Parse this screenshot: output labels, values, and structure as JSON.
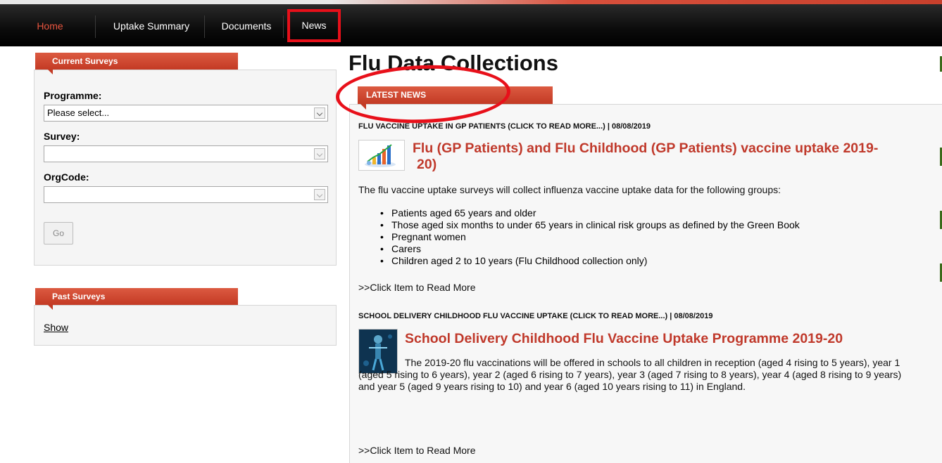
{
  "nav": {
    "home": "Home",
    "uptake_summary": "Uptake Summary",
    "documents": "Documents",
    "news": "News"
  },
  "current_surveys": {
    "title": "Current Surveys",
    "programme_label": "Programme:",
    "programme_value": "Please select...",
    "survey_label": "Survey:",
    "survey_value": "",
    "orgcode_label": "OrgCode:",
    "orgcode_value": "",
    "go_label": "Go"
  },
  "past_surveys": {
    "title": "Past Surveys",
    "show_label": "Show"
  },
  "main": {
    "page_title": "Flu Data Collections",
    "latest_news_label": "LATEST NEWS",
    "articles": [
      {
        "headline": "FLU VACCINE UPTAKE IN GP PATIENTS (CLICK TO READ MORE...) | 08/08/2019",
        "title": "Flu (GP Patients) and Flu Childhood (GP Patients) vaccine uptake 2019-20)",
        "intro": "The flu vaccine uptake surveys will collect influenza vaccine uptake data for the following groups:",
        "bullets": [
          "Patients aged 65 years and older",
          "Those aged six months to under 65 years in clinical risk groups as defined by the Green Book",
          "Pregnant women",
          "Carers",
          "Children aged 2 to 10 years (Flu Childhood collection only)"
        ],
        "read_more": ">>Click Item to Read More"
      },
      {
        "headline": "SCHOOL DELIVERY CHILDHOOD FLU VACCINE UPTAKE (CLICK TO READ MORE...) | 08/08/2019",
        "title": "School Delivery Childhood Flu Vaccine Uptake Programme 2019-20",
        "body": "The 2019-20 flu vaccinations will be offered in schools to all children in reception (aged 4 rising to 5 years), year 1 (aged 5 rising to 6 years), year 2 (aged 6 rising to 7 years), year 3 (aged 7 rising to 8 years), year 4 (aged 8 rising to 9 years) and year 5 (aged 9 years rising to 10) and year 6 (aged 10 years rising to 11) in England.",
        "read_more": ">>Click Item to Read More"
      }
    ]
  },
  "colors": {
    "accent": "#c33a24",
    "title_red": "#c0392b",
    "annotation_red": "#e8101a",
    "nav_bg": "#000000"
  }
}
